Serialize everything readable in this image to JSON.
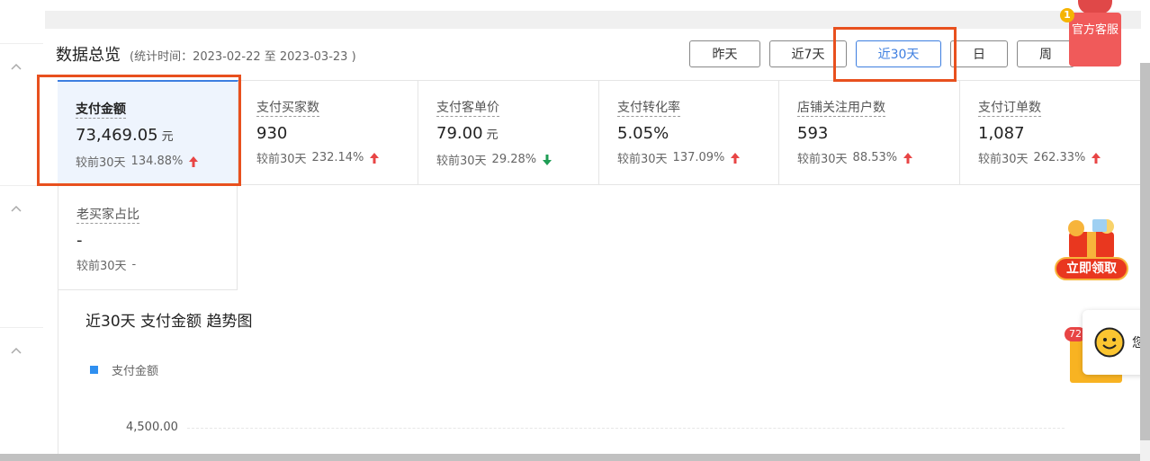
{
  "header": {
    "title": "数据总览",
    "stat_time": "(统计时间：2023-02-22 至 2023-03-23 )"
  },
  "range_tabs": [
    {
      "label": "昨天",
      "active": false
    },
    {
      "label": "近7天",
      "active": false
    },
    {
      "label": "近30天",
      "active": true
    },
    {
      "label": "日",
      "active": false
    },
    {
      "label": "周",
      "active": false
    }
  ],
  "metrics": [
    {
      "label": "支付金额",
      "value": "73,469.05",
      "unit": "元",
      "compare_label": "较前30天",
      "change": "134.88%",
      "trend": "up"
    },
    {
      "label": "支付买家数",
      "value": "930",
      "unit": "",
      "compare_label": "较前30天",
      "change": "232.14%",
      "trend": "up"
    },
    {
      "label": "支付客单价",
      "value": "79.00",
      "unit": "元",
      "compare_label": "较前30天",
      "change": "29.28%",
      "trend": "down"
    },
    {
      "label": "支付转化率",
      "value": "5.05%",
      "unit": "",
      "compare_label": "较前30天",
      "change": "137.09%",
      "trend": "up"
    },
    {
      "label": "店铺关注用户数",
      "value": "593",
      "unit": "",
      "compare_label": "较前30天",
      "change": "88.53%",
      "trend": "up"
    },
    {
      "label": "支付订单数",
      "value": "1,087",
      "unit": "",
      "compare_label": "较前30天",
      "change": "262.33%",
      "trend": "up"
    }
  ],
  "metric_row2": {
    "label": "老买家占比",
    "value": "-",
    "compare_label": "较前30天",
    "change": "-"
  },
  "chart": {
    "title": "近30天 支付金额 趋势图",
    "legend": "支付金额",
    "y_tick": "4,500.00"
  },
  "chart_data": {
    "type": "line",
    "title": "近30天 支付金额 趋势图",
    "series": [
      {
        "name": "支付金额",
        "values": []
      }
    ],
    "y_ticks": [
      "4,500.00"
    ],
    "legend_position": "top-left"
  },
  "widgets": {
    "service_label": "官方客服",
    "service_badge": "1",
    "coupon_label": "立即领取",
    "chat_badge": "72",
    "chat_text": "您"
  },
  "colors": {
    "accent": "#3d7ee0",
    "highlight": "#e8501e",
    "up": "#e84545",
    "down": "#1f9d55",
    "legend": "#2f8ff0"
  }
}
